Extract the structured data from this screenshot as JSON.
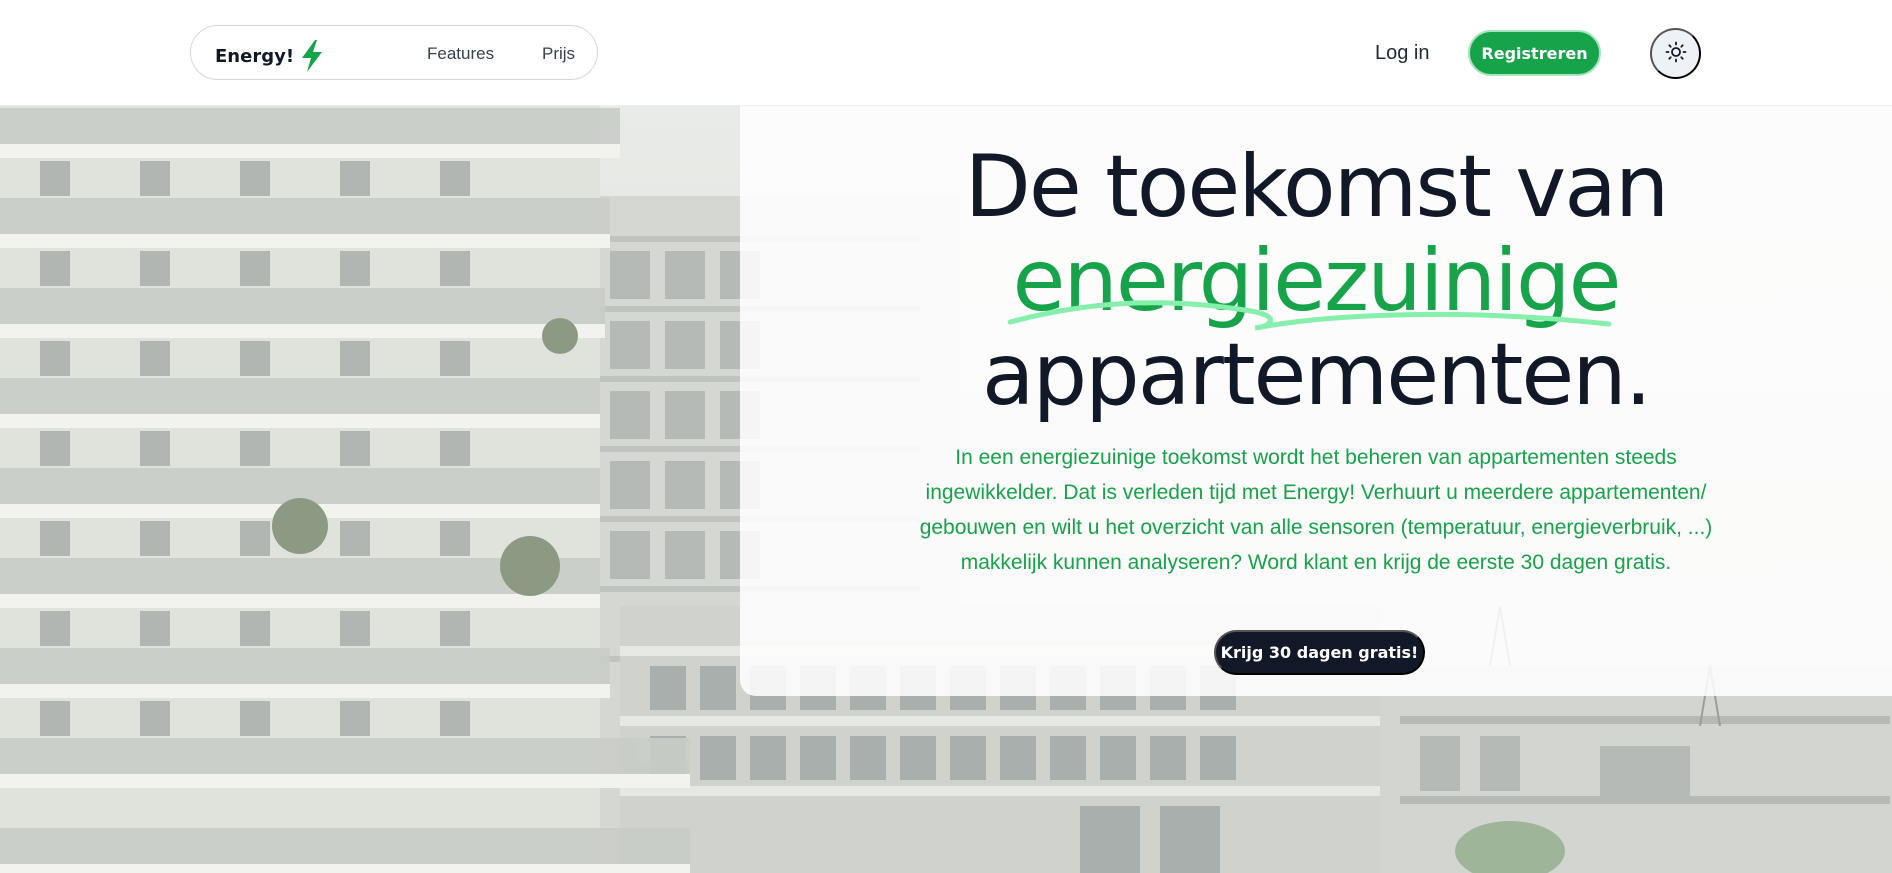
{
  "brand": {
    "name": "Energy!",
    "icon": "lightning-bolt-icon",
    "accent_color": "#16a34a"
  },
  "nav": {
    "links": [
      {
        "label": "Features"
      },
      {
        "label": "Prijs"
      }
    ]
  },
  "header_actions": {
    "login_label": "Log in",
    "register_label": "Registreren",
    "theme_icon": "sun-icon"
  },
  "hero": {
    "headline_line1": "De toekomst van",
    "headline_accent": "energiezuinige",
    "headline_line3": "appartementen.",
    "intro": "In een energiezuinige toekomst wordt het beheren van appartementen steeds ingewikkelder. Dat is verleden tijd met Energy! Verhuurt u meerdere appartementen/ gebouwen en wilt u het overzicht van alle sensoren (temperatuur, energieverbruik, ...) makkelijk kunnen analyseren? Word klant en krijg de eerste 30 dagen gratis.",
    "cta_label": "Krijg 30 dagen gratis!",
    "background_image": "apartment-buildings-photo"
  },
  "colors": {
    "text_dark": "#111827",
    "green": "#16a34a",
    "cta_bg": "#111827"
  }
}
